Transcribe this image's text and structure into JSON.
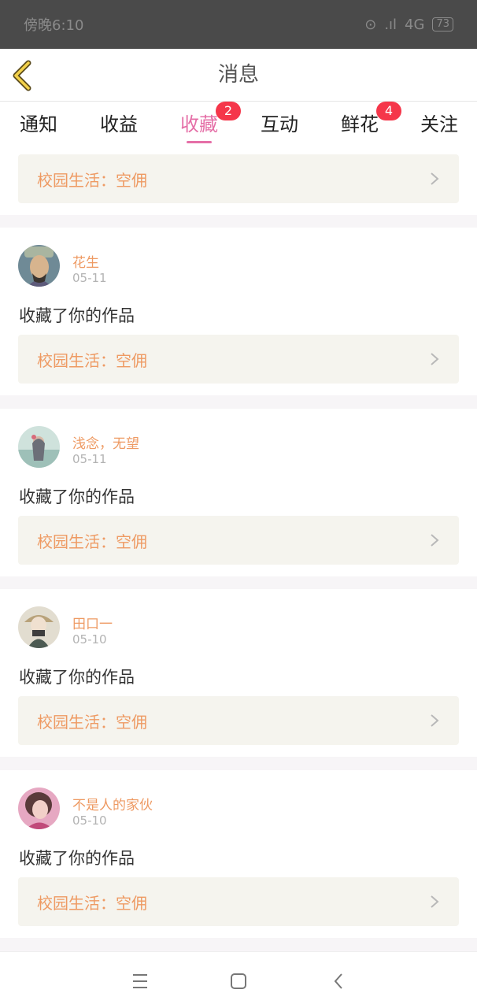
{
  "status_bar": {
    "time": "傍晚6:10",
    "network": "4G",
    "battery": "73"
  },
  "header": {
    "title": "消息",
    "back_icon": "chevron-left-icon"
  },
  "tabs": [
    {
      "label": "通知",
      "badge": ""
    },
    {
      "label": "收益",
      "badge": ""
    },
    {
      "label": "收藏",
      "badge": "2",
      "active": true
    },
    {
      "label": "互动",
      "badge": ""
    },
    {
      "label": "鲜花",
      "badge": "4"
    },
    {
      "label": "关注",
      "badge": ""
    }
  ],
  "top_work": {
    "title": "校园生活：空佣"
  },
  "items": [
    {
      "user": "花生",
      "date": "05-11",
      "action": "收藏了你的作品",
      "work": "校园生活：空佣"
    },
    {
      "user": "浅念，无望",
      "date": "05-11",
      "action": "收藏了你的作品",
      "work": "校园生活：空佣"
    },
    {
      "user": "田口一",
      "date": "05-10",
      "action": "收藏了你的作品",
      "work": "校园生活：空佣"
    },
    {
      "user": "不是人的家伙",
      "date": "05-10",
      "action": "收藏了你的作品",
      "work": "校园生活：空佣"
    }
  ],
  "colors": {
    "accent_pink": "#e56fa7",
    "badge_red": "#f5364a",
    "work_orange": "#ee9a63",
    "work_bg": "#f5f4ee"
  },
  "nav": {
    "menu_icon": "menu-icon",
    "home_icon": "square-home-icon",
    "back_icon": "back-chevron-icon"
  }
}
